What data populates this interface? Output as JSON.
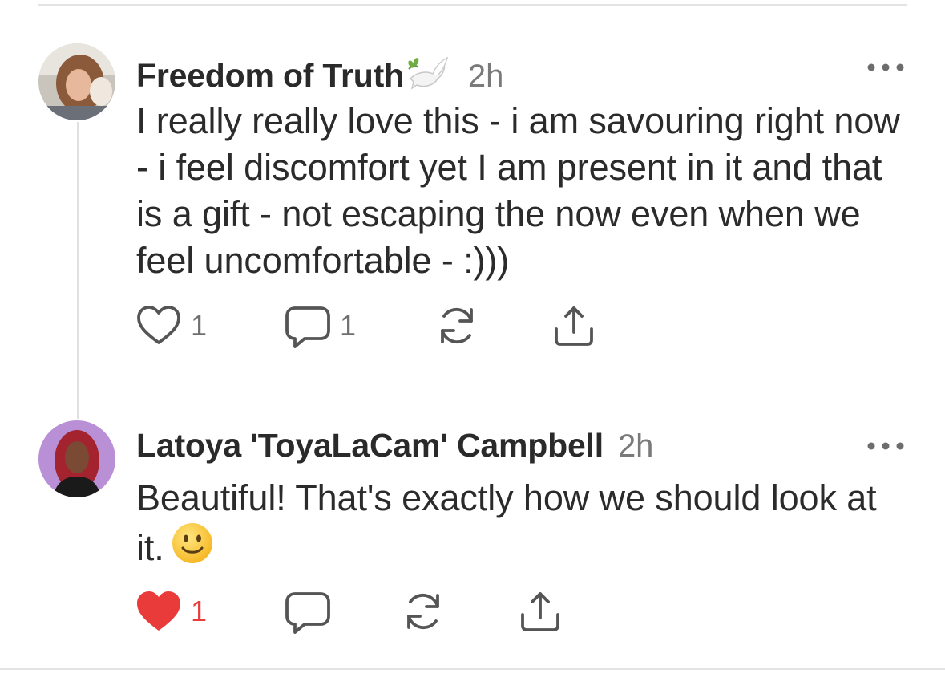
{
  "comments": [
    {
      "author": "Freedom of Truth",
      "flair_icon": "dove-with-olive-branch",
      "time": "2h",
      "text": "I really really love this - i am savouring right now - i feel discomfort yet I am present in it and that is a gift - not escaping the now even when we feel uncomfortable - :)))",
      "likes": "1",
      "replies": "1",
      "liked": false
    },
    {
      "author": "Latoya 'ToyaLaCam' Campbell",
      "time": "2h",
      "text": "Beautiful! That's exactly how we should look at it.",
      "emoji": "slightly-smiling-face",
      "likes": "1",
      "liked": true
    }
  ],
  "colors": {
    "like_active": "#ea3b3b",
    "icon_gray": "#555555",
    "text_secondary": "#7a7a7a"
  }
}
